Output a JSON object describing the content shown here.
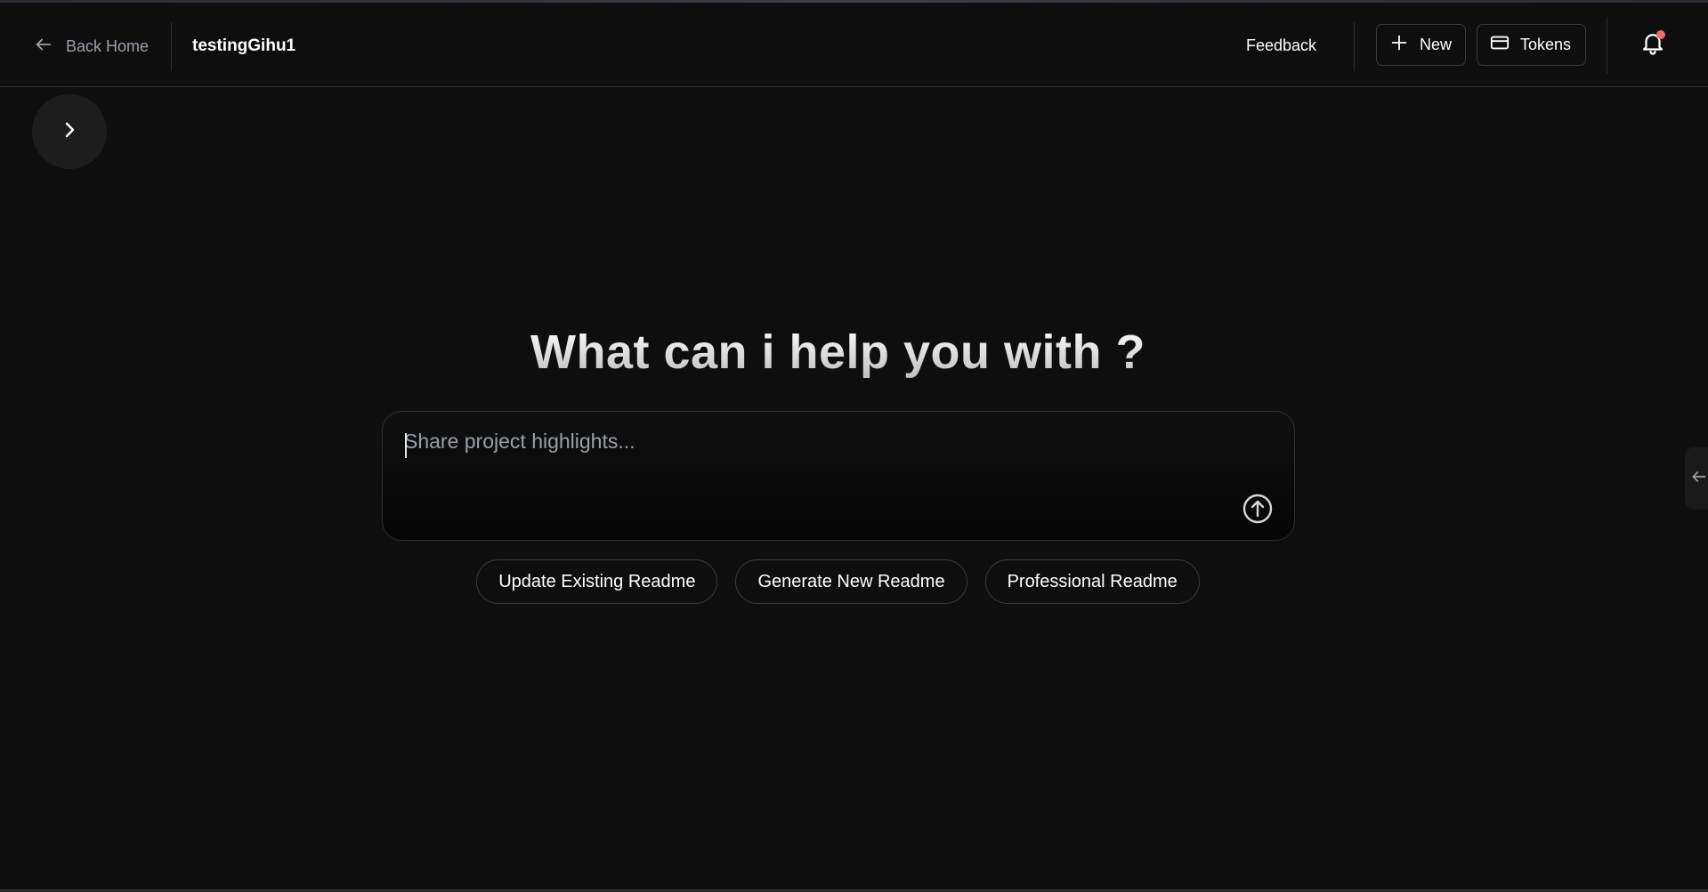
{
  "header": {
    "back_label": "Back Home",
    "project_name": "testingGihu1",
    "feedback_label": "Feedback",
    "new_label": "New",
    "tokens_label": "Tokens",
    "notification_unread": true
  },
  "main": {
    "headline": "What can i help you with ?",
    "prompt": {
      "placeholder": "Share project highlights...",
      "value": ""
    },
    "suggestions": [
      {
        "label": "Update Existing Readme"
      },
      {
        "label": "Generate New Readme"
      },
      {
        "label": "Professional Readme"
      }
    ]
  },
  "icons": {
    "back": "arrow-left-icon",
    "new": "plus-icon",
    "tokens": "credit-card-icon",
    "notifications": "bell-icon",
    "sidebar": "chevron-right-icon",
    "send": "arrow-up-circle-icon",
    "right_panel": "arrow-left-icon"
  },
  "colors": {
    "background": "#0e0e0e",
    "border": "#2f2f2f",
    "notification_dot": "#ef6b6b",
    "muted_text": "#9aa0a8"
  }
}
